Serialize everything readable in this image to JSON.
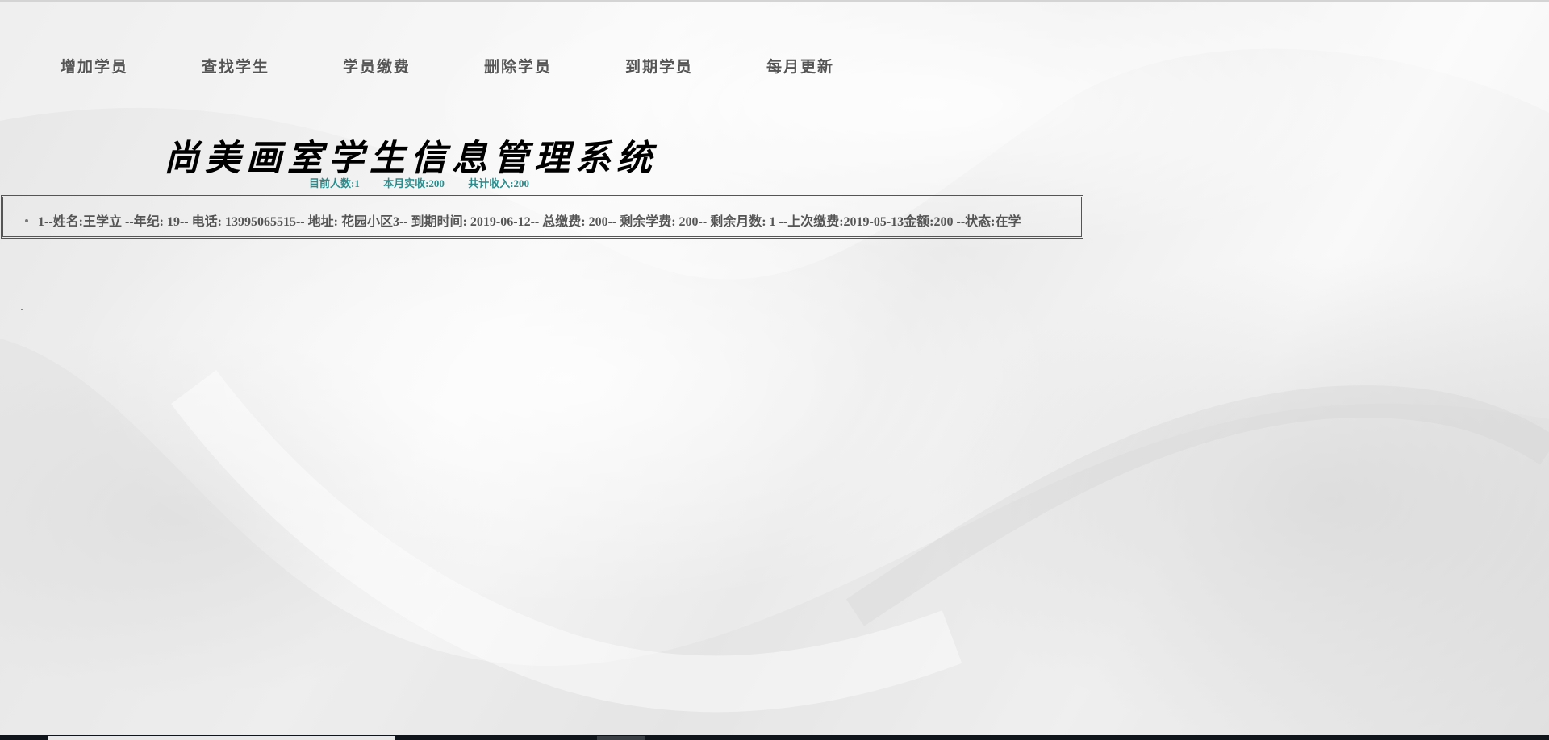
{
  "nav": {
    "items": [
      "增加学员",
      "查找学生",
      "学员缴费",
      "删除学员",
      "到期学员",
      "每月更新"
    ]
  },
  "header": {
    "title": "尚美画室学生信息管理系统"
  },
  "stats": {
    "current_count": "目前人数:1",
    "month_income": "本月实收:200",
    "total_income": "共计收入:200"
  },
  "records": [
    "1--姓名:王学立 --年纪: 19-- 电话: 13995065515-- 地址: 花园小区3-- 到期时间: 2019-06-12-- 总缴费: 200-- 剩余学费: 200-- 剩余月数: 1 --上次缴费:2019-05-13金额:200 --状态:在学"
  ],
  "colors": {
    "nav_text": "#555555",
    "stats_text": "#2a8c8c",
    "title_text": "#000000",
    "record_text": "#555555"
  }
}
